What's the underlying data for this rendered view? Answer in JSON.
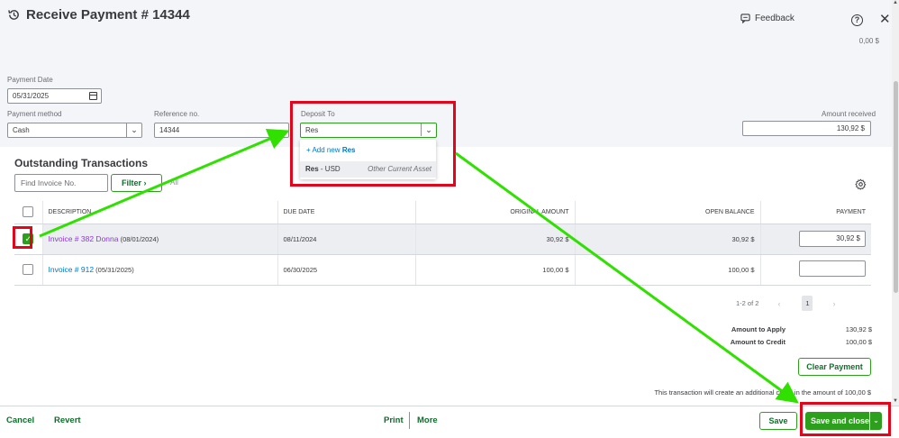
{
  "header": {
    "title": "Receive Payment # 14344",
    "feedback_label": "Feedback",
    "help_label": "?",
    "close_label": "✕",
    "top_amount": "0,00 $"
  },
  "form": {
    "payment_date": {
      "label": "Payment Date",
      "value": "05/31/2025"
    },
    "payment_method": {
      "label": "Payment method",
      "value": "Cash"
    },
    "reference_no": {
      "label": "Reference no.",
      "value": "14344"
    },
    "deposit_to": {
      "label": "Deposit To",
      "value": "Res"
    },
    "amount_received": {
      "label": "Amount received",
      "value": "130,92 $"
    }
  },
  "deposit_dropdown": {
    "add_prefix": "+  Add new",
    "add_term": "Res",
    "option_name": "Res",
    "option_currency": " - USD",
    "option_type": "Other Current Asset"
  },
  "outstanding": {
    "title": "Outstanding Transactions",
    "find_placeholder": "Find Invoice No.",
    "filter_label": "Filter  ›",
    "all_label": "All",
    "columns": [
      "DESCRIPTION",
      "DUE DATE",
      "ORIGINAL AMOUNT",
      "OPEN BALANCE",
      "PAYMENT"
    ],
    "rows": [
      {
        "checked": true,
        "invoice": "Invoice # 382 Donna",
        "date": "(08/01/2024)",
        "due": "08/11/2024",
        "original": "30,92 $",
        "open": "30,92 $",
        "payment": "30,92 $"
      },
      {
        "checked": false,
        "invoice": "Invoice # 912",
        "date": "(05/31/2025)",
        "due": "06/30/2025",
        "original": "100,00 $",
        "open": "100,00 $",
        "payment": ""
      }
    ],
    "pager": {
      "range": "1-2 of 2",
      "prev": "‹",
      "page": "1",
      "next": "›"
    }
  },
  "totals": {
    "apply_label": "Amount to Apply",
    "apply_value": "130,92 $",
    "credit_label": "Amount to Credit",
    "credit_value": "100,00 $",
    "clear_label": "Clear Payment",
    "credit_note": "This transaction will create an additional credit in the amount of 100,00 $"
  },
  "footer": {
    "cancel": "Cancel",
    "revert": "Revert",
    "print": "Print",
    "more": "More",
    "save": "Save",
    "save_close": "Save and close",
    "split_arrow": "⌄"
  },
  "colors": {
    "accent_green": "#2ca01c",
    "link_blue": "#0077c5",
    "annotation_red": "#e3051a",
    "annotation_arrow": "#2fe000"
  }
}
